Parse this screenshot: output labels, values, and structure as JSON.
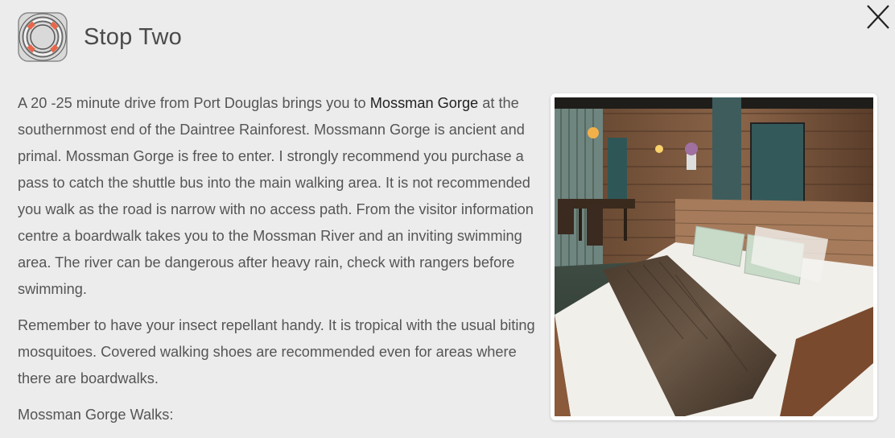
{
  "modal": {
    "title": "Stop Two",
    "close_icon": "close-x-icon",
    "logo_icon": "lifebuoy-icon"
  },
  "content": {
    "para1_before": "A 20 -25 minute drive from Port Douglas brings you to ",
    "para1_link": "Mossman Gorge",
    "para1_after": " at the southernmost end of the Daintree Rainforest. Mossmann Gorge is ancient and primal. Mossman Gorge is free to enter. I strongly recommend you purchase a pass to catch the shuttle bus into the main walking area. It is not recommended you walk as the road is narrow with no access path. From the visitor information centre a boardwalk takes you to the Mossman River and an inviting swimming area. The river can be dangerous after heavy rain, check with rangers before swimming.",
    "para2": "Remember to have your insect repellant handy. It is tropical with the usual biting mosquitoes. Covered walking shoes are recommended even for areas where there are boardwalks.",
    "para3": "Mossman Gorge Walks:"
  },
  "colors": {
    "background": "#ececec",
    "text": "#555555",
    "link": "#222222",
    "lifebuoy_orange": "#e8664a"
  }
}
